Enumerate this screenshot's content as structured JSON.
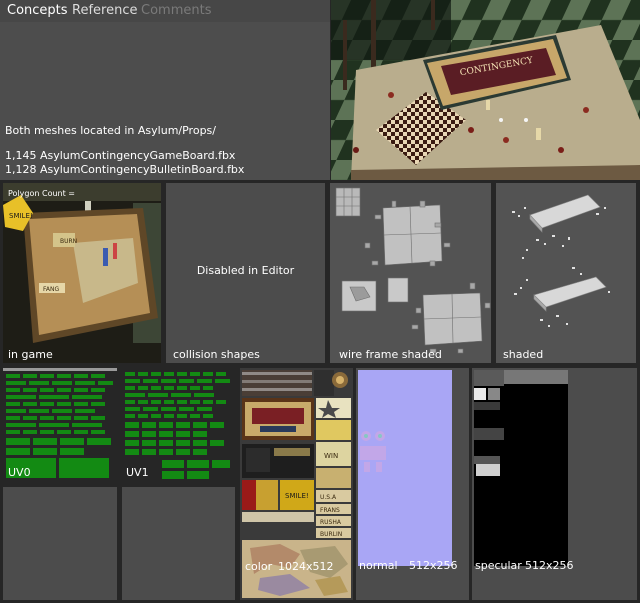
{
  "tabs": [
    {
      "label": "Concepts",
      "state": "active"
    },
    {
      "label": "Reference",
      "state": "normal"
    },
    {
      "label": "Comments",
      "state": "disabled"
    }
  ],
  "info": {
    "mesh_location": "Both meshes located in Asylum/Props/",
    "mesh_1": "1,145 AsylumContingencyGameBoard.fbx",
    "mesh_2": "1,128 AsylumContingencyBulletinBoard.fbx"
  },
  "hero": {
    "board_title": "CONTINGENCY"
  },
  "views": [
    {
      "label": "in game",
      "overlay": "Polygon Count ="
    },
    {
      "label": "collision shapes",
      "center_text": "Disabled in Editor"
    },
    {
      "label": "wire frame shaded"
    },
    {
      "label": "shaded"
    }
  ],
  "in_game_cards": {
    "smile": "SMILE!",
    "burn": "BURN",
    "fang": "FANG"
  },
  "textures": {
    "uv0": "UV0",
    "uv1": "UV1",
    "color": "color",
    "color_size": "1024x512",
    "normal": "normal",
    "normal_size": "512x256",
    "specular": "specular",
    "specular_size": "512x256"
  },
  "color_tex_text": {
    "win": "WIN",
    "smile": "SMILE!",
    "names": [
      "U.S.A",
      "FRANS",
      "RUSHA",
      "BURLIN"
    ]
  },
  "colors": {
    "uv_green": "#138a13",
    "normal_blue": "#a9a6f5",
    "bg": "#262626",
    "panel": "#4c4c4c"
  }
}
